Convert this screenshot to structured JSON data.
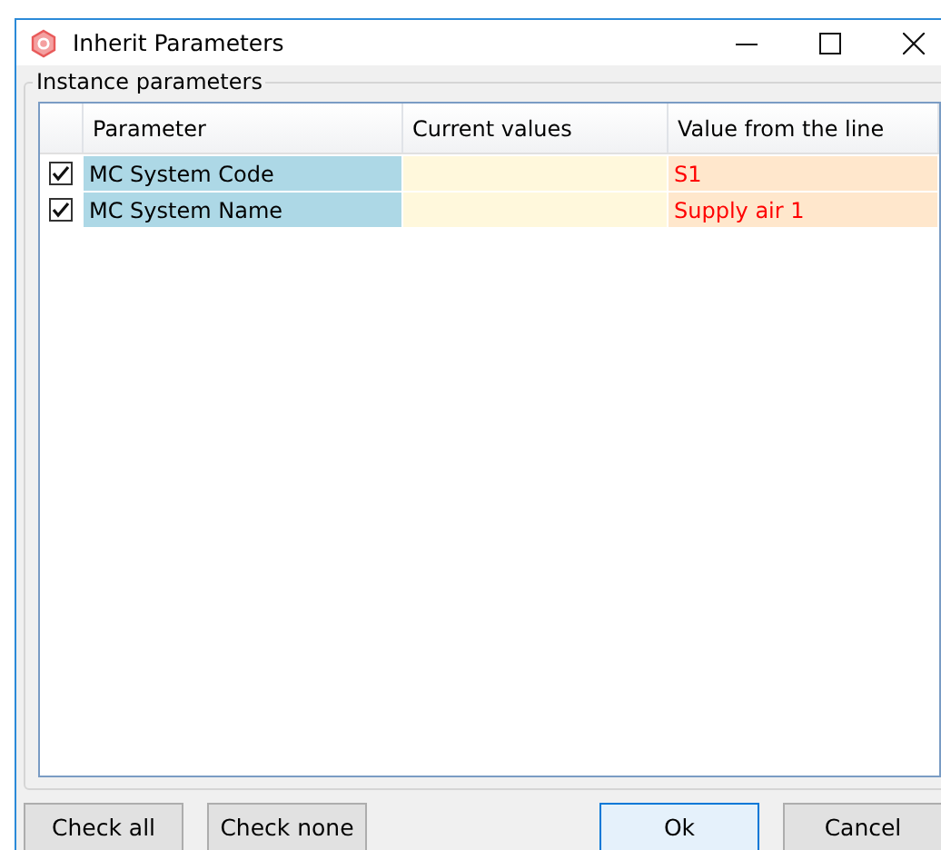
{
  "window": {
    "title": "Inherit Parameters"
  },
  "group": {
    "title": "Instance parameters"
  },
  "table": {
    "columns": [
      "Parameter",
      "Current values",
      "Value from the line"
    ],
    "rows": [
      {
        "checked": true,
        "parameter": "MC System Code",
        "current": "",
        "value": "S1"
      },
      {
        "checked": true,
        "parameter": "MC System Name",
        "current": "",
        "value": "Supply air 1"
      }
    ]
  },
  "buttons": [
    {
      "label": "Check all",
      "kind": "left",
      "focused": false
    },
    {
      "label": "Check none",
      "kind": "left",
      "focused": false
    },
    {
      "label": "Ok",
      "kind": "right",
      "focused": true
    },
    {
      "label": "Cancel",
      "kind": "right",
      "focused": false
    }
  ]
}
